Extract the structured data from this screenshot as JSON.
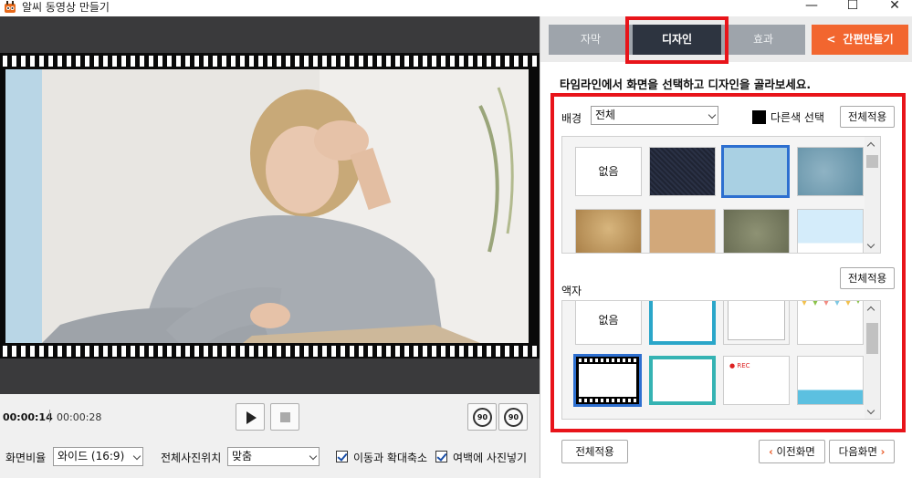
{
  "window": {
    "title": "알씨 동영상 만들기",
    "minimize": "—",
    "maximize": "☐",
    "close": "✕"
  },
  "player": {
    "current_time": "00:00:14",
    "total_time": "00:00:28",
    "rotate_left_label": "90",
    "rotate_right_label": "90"
  },
  "options": {
    "aspect_label": "화면비율",
    "aspect_value": "와이드 (16:9)",
    "position_label": "전체사진위치",
    "position_value": "맞춤",
    "zoom_label": "이동과 확대축소",
    "margin_label": "여백에 사진넣기"
  },
  "tabs": [
    {
      "label": "자막"
    },
    {
      "label": "디자인"
    },
    {
      "label": "효과"
    },
    {
      "label": "간편만들기",
      "icon": "<"
    }
  ],
  "design": {
    "instruction": "타임라인에서 화면을 선택하고 디자인을 골라보세요.",
    "background_label": "배경",
    "background_filter": "전체",
    "other_color_label": "다른색 선택",
    "apply_all_bg": "전체적용",
    "none_label": "없음",
    "frame_label": "액자",
    "apply_all_frame": "전체적용",
    "none_frame_label": "없음",
    "rec_label": "● REC"
  },
  "footer": {
    "apply_all": "전체적용",
    "prev": "이전화면",
    "next": "다음화면"
  },
  "colors": {
    "accent_orange": "#f2662f",
    "tab_dark": "#2d3440",
    "highlight_red": "#e8141a",
    "select_blue": "#2d6fd0"
  }
}
